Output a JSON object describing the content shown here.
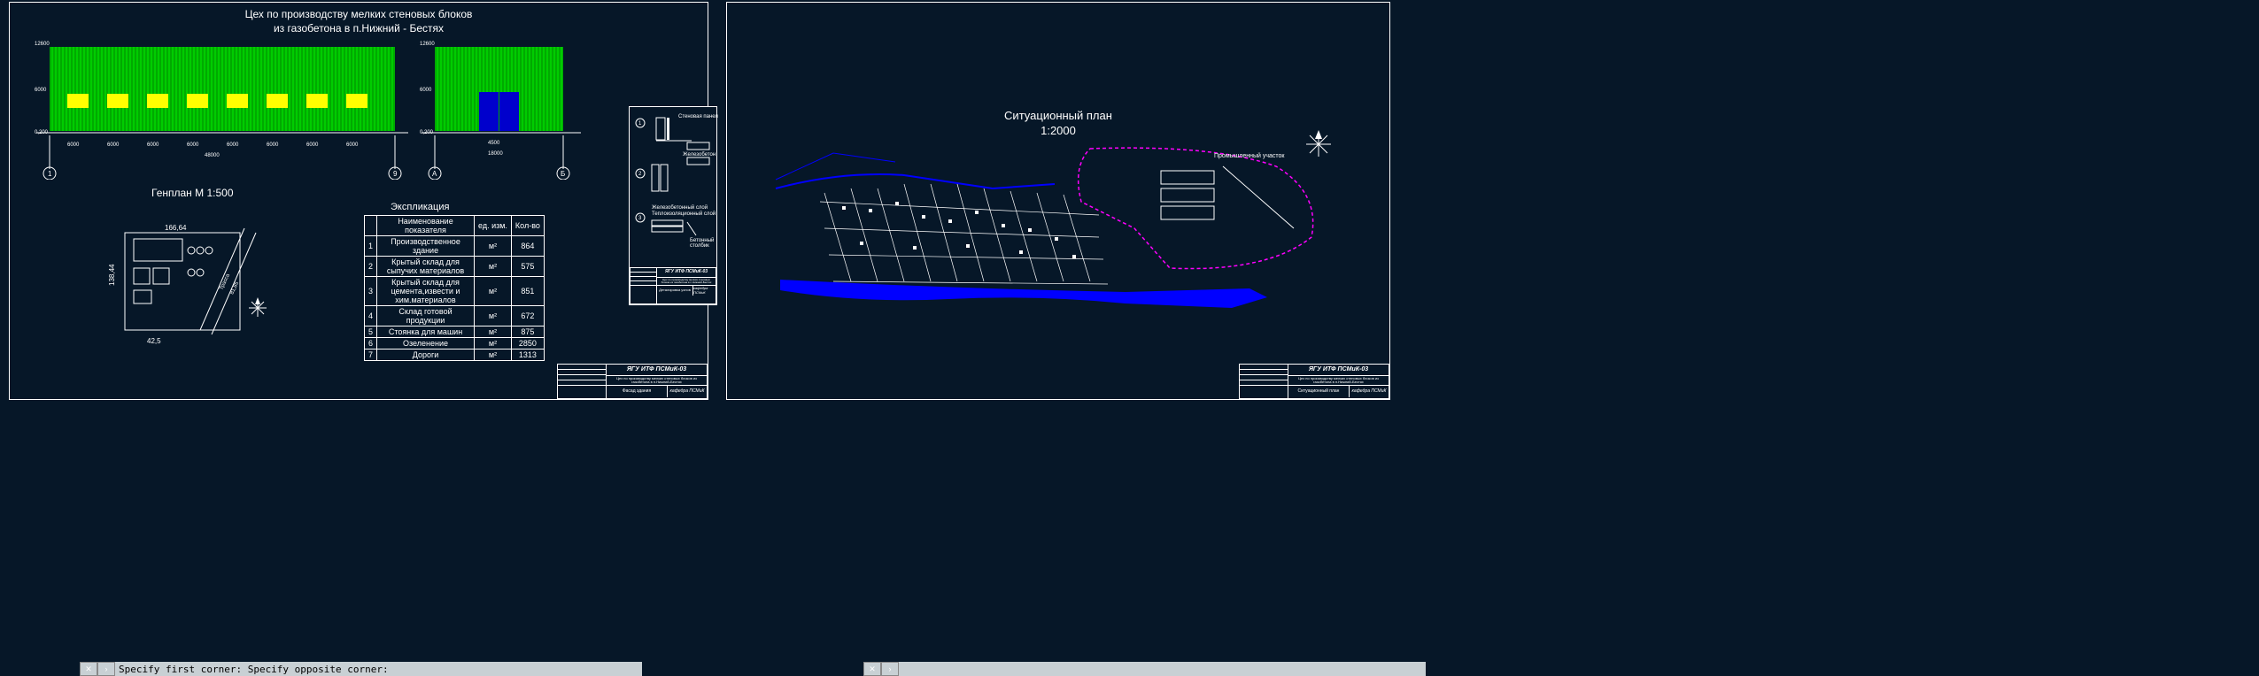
{
  "sheet1": {
    "title_line1": "Цех по производству мелких стеновых блоков",
    "title_line2": "из газобетона в п.Нижний - Бестях",
    "elev1": {
      "dims_v": [
        "12600",
        "6000",
        "0,200"
      ],
      "dims_h_each": "6000",
      "total_span": "48000",
      "axes": [
        "1",
        "9"
      ]
    },
    "elev2": {
      "dims_v": [
        "12600",
        "6000",
        "0,200"
      ],
      "door_dim": "4500",
      "total_span": "18000",
      "axes": [
        "А",
        "Б"
      ]
    },
    "genplan_title": "Генплан М 1:500",
    "genplan_dims": {
      "w": "166,64",
      "h": "138,44",
      "bottom": "42,5",
      "road": "Трасса",
      "road_dim": "81,85"
    },
    "explication_title": "Экспликация",
    "explication_headers": [
      "",
      "Наименование показателя",
      "ед. изм.",
      "Кол-во"
    ],
    "explication_rows": [
      {
        "n": "1",
        "name": "Производственное здание",
        "unit": "м²",
        "val": "864"
      },
      {
        "n": "2",
        "name": "Крытый склад для сыпучих материалов",
        "unit": "м²",
        "val": "575"
      },
      {
        "n": "3",
        "name": "Крытый склад для цемента,извести и хим.материалов",
        "unit": "м²",
        "val": "851"
      },
      {
        "n": "4",
        "name": "Склад готовой продукции",
        "unit": "м²",
        "val": "672"
      },
      {
        "n": "5",
        "name": "Стоянка для машин",
        "unit": "м²",
        "val": "875"
      },
      {
        "n": "6",
        "name": "Озеленение",
        "unit": "м²",
        "val": "2850"
      },
      {
        "n": "7",
        "name": "Дороги",
        "unit": "м²",
        "val": "1313"
      }
    ]
  },
  "stamp": {
    "org": "ЯГУ ИТФ ПСМиК-03",
    "project1": "Цех по производству мелких стеновых блоков из газобетона в п.Нижний-Бестях",
    "drawing1": "Фасад здания",
    "drawing_detail": "Деталировка узлов",
    "drawing2": "Ситуационный план",
    "kafedra": "кафедра ПСМиК"
  },
  "sheet2": {
    "title_line1": "Ситуационный план",
    "title_line2": "1:2000",
    "labels": {
      "airfield": "Промышленный участок"
    }
  },
  "cmdline": "Specify first corner: Specify opposite corner:"
}
